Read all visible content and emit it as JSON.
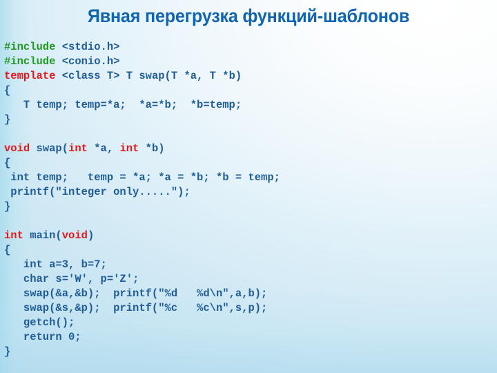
{
  "slide": {
    "title": "Явная перегрузка функций-шаблонов",
    "colors": {
      "title": "#1165b0",
      "keyword_red": "#e8161a",
      "preprocessor_green": "#1f9a20",
      "code_blue": "#1f5c96",
      "background_light": "#ffffff",
      "background_tint": "#bcdfee"
    },
    "code": {
      "language": "c",
      "lines": [
        {
          "id": "l01",
          "spans": [
            {
              "t": "#include ",
              "c": "pp"
            },
            {
              "t": "<stdio.h>",
              "c": "blu"
            }
          ]
        },
        {
          "id": "l02",
          "spans": [
            {
              "t": "#include ",
              "c": "pp"
            },
            {
              "t": "<conio.h>",
              "c": "blu"
            }
          ]
        },
        {
          "id": "l03",
          "spans": [
            {
              "t": "template",
              "c": "kw"
            },
            {
              "t": " <class T> T swap(T *a, T *b)",
              "c": "blu"
            }
          ]
        },
        {
          "id": "l04",
          "spans": [
            {
              "t": "{",
              "c": "blu"
            }
          ]
        },
        {
          "id": "l05",
          "spans": [
            {
              "t": "   T temp; temp=*a;  *a=*b;  *b=temp;",
              "c": "blu"
            }
          ]
        },
        {
          "id": "l06",
          "spans": [
            {
              "t": "}",
              "c": "blu"
            }
          ]
        },
        {
          "id": "l07",
          "spans": [
            {
              "t": "",
              "c": "blu"
            }
          ]
        },
        {
          "id": "l08",
          "spans": [
            {
              "t": "void",
              "c": "kw"
            },
            {
              "t": " swap(",
              "c": "blu"
            },
            {
              "t": "int",
              "c": "kw"
            },
            {
              "t": " *a, ",
              "c": "blu"
            },
            {
              "t": "int",
              "c": "kw"
            },
            {
              "t": " *b)",
              "c": "blu"
            }
          ]
        },
        {
          "id": "l09",
          "spans": [
            {
              "t": "{",
              "c": "blu"
            }
          ]
        },
        {
          "id": "l10",
          "spans": [
            {
              "t": " int temp;   temp = *a; *a = *b; *b = temp;",
              "c": "blu"
            }
          ]
        },
        {
          "id": "l11",
          "spans": [
            {
              "t": " printf(\"integer only.....\");",
              "c": "blu"
            }
          ]
        },
        {
          "id": "l12",
          "spans": [
            {
              "t": "}",
              "c": "blu"
            }
          ]
        },
        {
          "id": "l13",
          "spans": [
            {
              "t": "",
              "c": "blu"
            }
          ]
        },
        {
          "id": "l14",
          "spans": [
            {
              "t": "int",
              "c": "kw"
            },
            {
              "t": " main(",
              "c": "blu"
            },
            {
              "t": "void",
              "c": "kw"
            },
            {
              "t": ")",
              "c": "blu"
            }
          ]
        },
        {
          "id": "l15",
          "spans": [
            {
              "t": "{",
              "c": "blu"
            }
          ]
        },
        {
          "id": "l16",
          "spans": [
            {
              "t": "   int a=3, b=7;",
              "c": "blu"
            }
          ]
        },
        {
          "id": "l17",
          "spans": [
            {
              "t": "   char s='W', p='Z';",
              "c": "blu"
            }
          ]
        },
        {
          "id": "l18",
          "spans": [
            {
              "t": "   swap(&a,&b);  printf(\"%d   %d\\n\",a,b);",
              "c": "blu"
            }
          ]
        },
        {
          "id": "l19",
          "spans": [
            {
              "t": "   swap(&s,&p);  printf(\"%c   %c\\n\",s,p);",
              "c": "blu"
            }
          ]
        },
        {
          "id": "l20",
          "spans": [
            {
              "t": "   getch();",
              "c": "blu"
            }
          ]
        },
        {
          "id": "l21",
          "spans": [
            {
              "t": "   return 0;",
              "c": "blu"
            }
          ]
        },
        {
          "id": "l22",
          "spans": [
            {
              "t": "}",
              "c": "blu"
            }
          ]
        }
      ]
    }
  }
}
